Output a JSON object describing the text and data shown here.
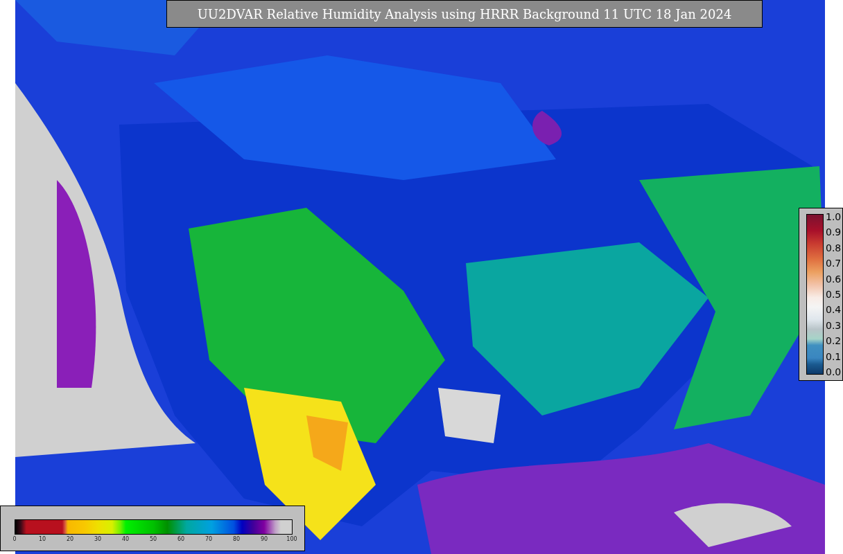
{
  "title": "UU2DVAR Relative Humidity Analysis using HRRR Background 11 UTC 18 Jan 2024",
  "vertical_colorbar": {
    "ticks": [
      "1.0",
      "0.9",
      "0.8",
      "0.7",
      "0.6",
      "0.5",
      "0.4",
      "0.3",
      "0.2",
      "0.1",
      "0.0"
    ]
  },
  "horizontal_colorbar": {
    "ticks": [
      "0",
      "10",
      "20",
      "30",
      "40",
      "50",
      "60",
      "70",
      "80",
      "90",
      "100"
    ]
  }
}
